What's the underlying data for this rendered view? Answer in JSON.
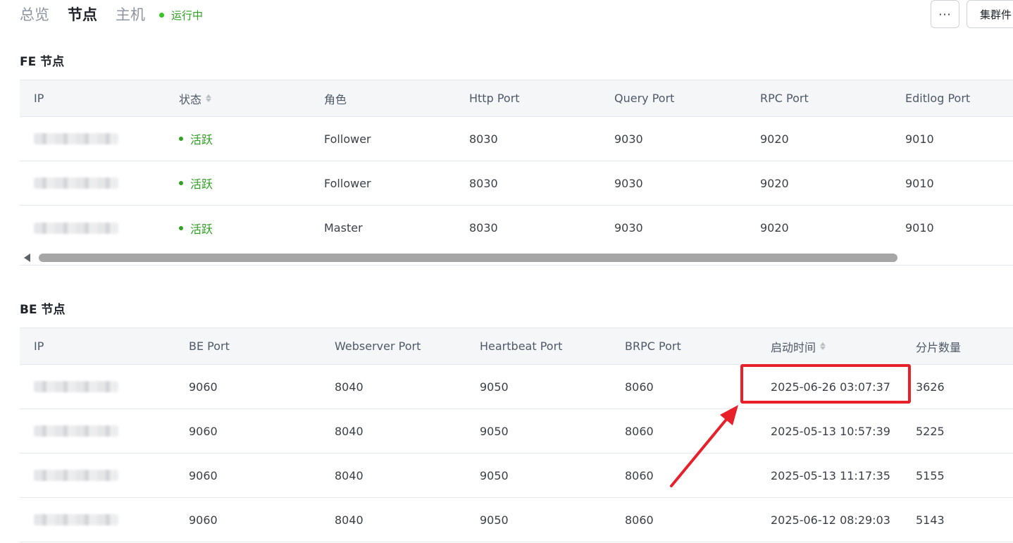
{
  "header": {
    "tabs": [
      {
        "label": "总览",
        "active": false
      },
      {
        "label": "节点",
        "active": true
      },
      {
        "label": "主机",
        "active": false
      }
    ],
    "status_label": "运行中",
    "status_color": "#2ea121",
    "more_label": "···",
    "cluster_button_label": "集群件"
  },
  "fe": {
    "title": "FE 节点",
    "columns": [
      "IP",
      "状态",
      "角色",
      "Http Port",
      "Query Port",
      "RPC Port",
      "Editlog Port"
    ],
    "sortable_column": "状态",
    "rows": [
      {
        "ip": "",
        "status": "活跃",
        "role": "Follower",
        "http_port": "8030",
        "query_port": "9030",
        "rpc_port": "9020",
        "editlog_port": "9010"
      },
      {
        "ip": "",
        "status": "活跃",
        "role": "Follower",
        "http_port": "8030",
        "query_port": "9030",
        "rpc_port": "9020",
        "editlog_port": "9010"
      },
      {
        "ip": "",
        "status": "活跃",
        "role": "Master",
        "http_port": "8030",
        "query_port": "9030",
        "rpc_port": "9020",
        "editlog_port": "9010"
      }
    ]
  },
  "be": {
    "title": "BE 节点",
    "columns": [
      "IP",
      "BE Port",
      "Webserver Port",
      "Heartbeat Port",
      "BRPC Port",
      "启动时间",
      "分片数量"
    ],
    "sortable_column": "启动时间",
    "rows": [
      {
        "ip": "",
        "be_port": "9060",
        "webserver_port": "8040",
        "heartbeat_port": "9050",
        "brpc_port": "8060",
        "start_time": "2025-06-26 03:07:37",
        "tablets": "3626"
      },
      {
        "ip": "",
        "be_port": "9060",
        "webserver_port": "8040",
        "heartbeat_port": "9050",
        "brpc_port": "8060",
        "start_time": "2025-05-13 10:57:39",
        "tablets": "5225"
      },
      {
        "ip": "",
        "be_port": "9060",
        "webserver_port": "8040",
        "heartbeat_port": "9050",
        "brpc_port": "8060",
        "start_time": "2025-05-13 11:17:35",
        "tablets": "5155"
      },
      {
        "ip": "",
        "be_port": "9060",
        "webserver_port": "8040",
        "heartbeat_port": "9050",
        "brpc_port": "8060",
        "start_time": "2025-06-12 08:29:03",
        "tablets": "5143"
      }
    ]
  },
  "annotation": {
    "color": "#e8202a",
    "highlighted_value": "2025-06-26 03:07:37"
  }
}
